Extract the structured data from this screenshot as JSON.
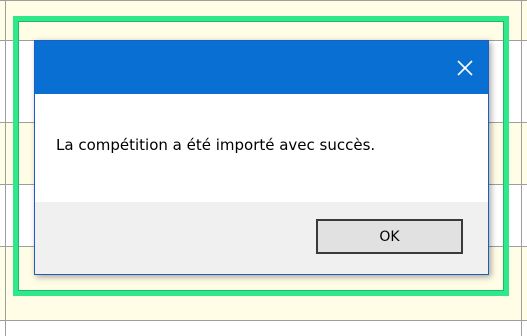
{
  "dialog": {
    "message": "La compétition a été importé avec succès.",
    "ok_label": "OK",
    "close_icon": "close-icon"
  },
  "colors": {
    "title_bar": "#0a6fd2",
    "highlight_frame": "#2ee88a",
    "button_area": "#f0f0f0",
    "background_row": "#fffde6"
  }
}
